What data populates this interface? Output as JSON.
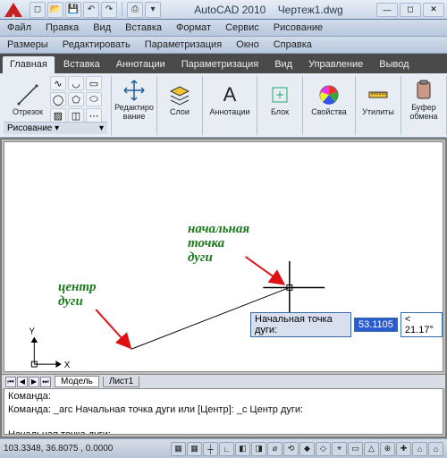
{
  "title": {
    "app": "AutoCAD 2010",
    "doc": "Чертеж1.dwg"
  },
  "qat": [
    "new",
    "open",
    "save",
    "undo",
    "redo",
    "print"
  ],
  "menu1": [
    "Файл",
    "Правка",
    "Вид",
    "Вставка",
    "Формат",
    "Сервис",
    "Рисование"
  ],
  "menu2": [
    "Размеры",
    "Редактировать",
    "Параметризация",
    "Окно",
    "Справка"
  ],
  "ribbon_tabs": [
    "Главная",
    "Вставка",
    "Аннотации",
    "Параметризация",
    "Вид",
    "Управление",
    "Вывод"
  ],
  "ribbon_active": 0,
  "panels": {
    "draw": {
      "main": "Отрезок",
      "footer": "Рисование ▾",
      "small_icons": [
        "line",
        "spline",
        "arc",
        "rect",
        "poly",
        "circ",
        "ellipse",
        "hatch",
        "more"
      ]
    },
    "modify": {
      "label": "Редактиро\nвание",
      "icon": "move-icon"
    },
    "layers": {
      "label": "Слои",
      "icon": "layers-icon"
    },
    "annot": {
      "label": "Аннотации",
      "icon": "text-icon"
    },
    "block": {
      "label": "Блок",
      "icon": "block-icon"
    },
    "props": {
      "label": "Свойства",
      "icon": "color-wheel-icon"
    },
    "utils": {
      "label": "Утилиты",
      "icon": "measure-icon"
    },
    "clip": {
      "label": "Буфер\nобмена",
      "icon": "clipboard-icon"
    }
  },
  "canvas": {
    "annot_start": "начальная\nточка\nдуги",
    "annot_center": "центр\nдуги",
    "axis_x": "X",
    "axis_y": "Y",
    "dyn_label": "Начальная точка дуги:",
    "dyn_value": "53.1105",
    "dyn_angle": "< 21.17°"
  },
  "layout_tabs": {
    "model": "Модель",
    "sheet": "Лист1"
  },
  "cmd": {
    "l1": "Команда:",
    "l2": "Команда: _arc Начальная точка дуги или [Центр]: _c Центр дуги:",
    "l3": "",
    "l4": "Начальная точка дуги:"
  },
  "status": {
    "coords": "103.3348, 36.8075 , 0.0000",
    "tray": [
      "▦",
      "▦",
      "┼",
      "∟",
      "◧",
      "◨",
      "⌀",
      "⟲",
      "◆",
      "◇",
      "⌖",
      "▭",
      "△",
      "⊕",
      "✚",
      "⌂",
      "⌂"
    ]
  }
}
